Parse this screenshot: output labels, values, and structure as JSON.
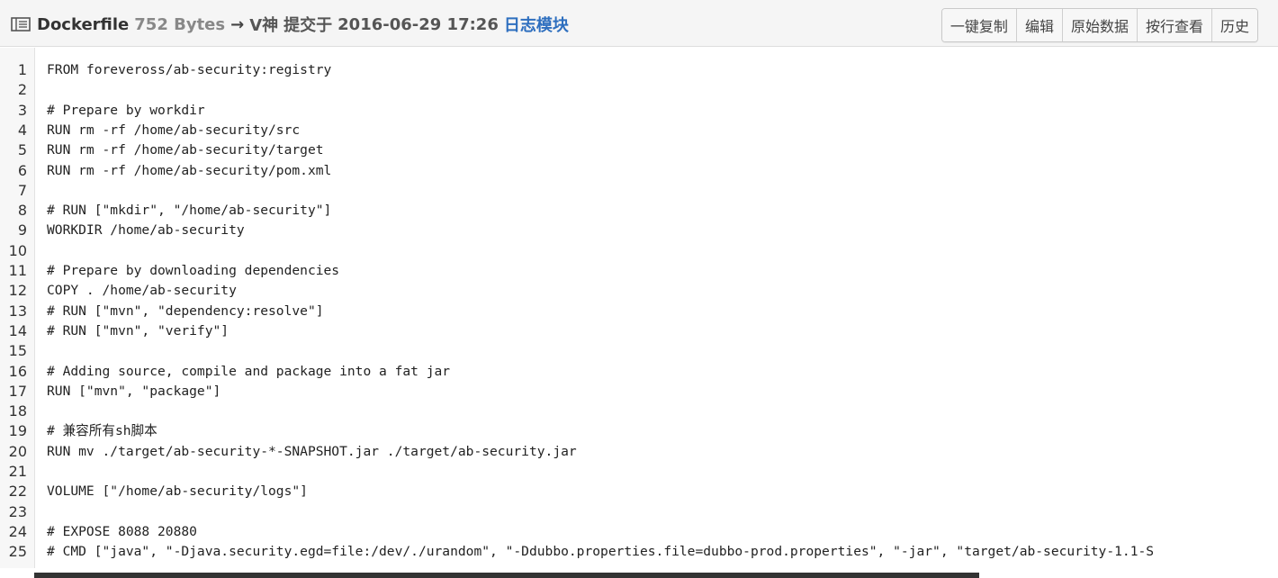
{
  "header": {
    "file_name": "Dockerfile",
    "file_size": "752 Bytes",
    "arrow": "→",
    "author": "V神",
    "commit_label": "提交于",
    "commit_date": "2016-06-29 17:26",
    "commit_message": "日志模块",
    "buttons": [
      "一键复制",
      "编辑",
      "原始数据",
      "按行查看",
      "历史"
    ]
  },
  "code": {
    "line_numbers": [
      "1",
      "2",
      "3",
      "4",
      "5",
      "6",
      "7",
      "8",
      "9",
      "10",
      "11",
      "12",
      "13",
      "14",
      "15",
      "16",
      "17",
      "18",
      "19",
      "20",
      "21",
      "22",
      "23",
      "24",
      "25"
    ],
    "lines": [
      "FROM foreveross/ab-security:registry",
      "",
      "# Prepare by workdir",
      "RUN rm -rf /home/ab-security/src",
      "RUN rm -rf /home/ab-security/target",
      "RUN rm -rf /home/ab-security/pom.xml",
      "",
      "# RUN [\"mkdir\", \"/home/ab-security\"]",
      "WORKDIR /home/ab-security",
      "",
      "# Prepare by downloading dependencies",
      "COPY . /home/ab-security",
      "# RUN [\"mvn\", \"dependency:resolve\"]",
      "# RUN [\"mvn\", \"verify\"]",
      "",
      "# Adding source, compile and package into a fat jar",
      "RUN [\"mvn\", \"package\"]",
      "",
      "# 兼容所有sh脚本",
      "RUN mv ./target/ab-security-*-SNAPSHOT.jar ./target/ab-security.jar",
      "",
      "VOLUME [\"/home/ab-security/logs\"]",
      "",
      "# EXPOSE 8088 20880",
      "# CMD [\"java\", \"-Djava.security.egd=file:/dev/./urandom\", \"-Ddubbo.properties.file=dubbo-prod.properties\", \"-jar\", \"target/ab-security-1.1-S"
    ]
  }
}
